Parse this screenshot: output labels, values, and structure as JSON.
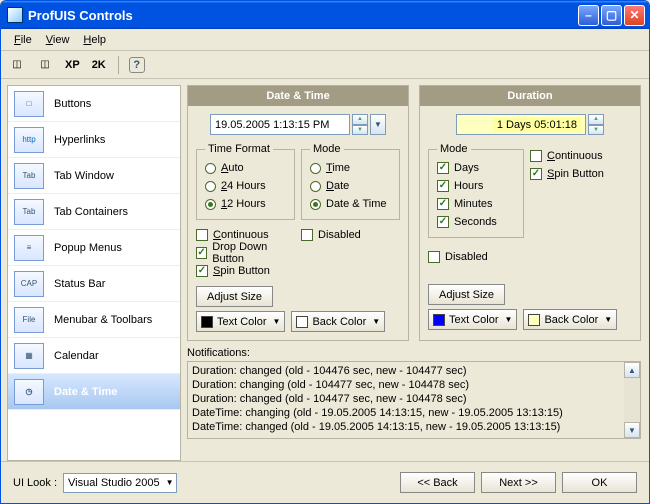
{
  "window": {
    "title": "ProfUIS Controls"
  },
  "menu": {
    "file": "File",
    "view": "View",
    "help": "Help"
  },
  "toolbar": {
    "xp": "XP",
    "k2": "2K"
  },
  "sidebar": {
    "items": [
      {
        "label": "Buttons",
        "thumb": "□"
      },
      {
        "label": "Hyperlinks",
        "thumb": "http"
      },
      {
        "label": "Tab Window",
        "thumb": "Tab"
      },
      {
        "label": "Tab Containers",
        "thumb": "Tab"
      },
      {
        "label": "Popup Menus",
        "thumb": "≡"
      },
      {
        "label": "Status Bar",
        "thumb": "CAP"
      },
      {
        "label": "Menubar & Toolbars",
        "thumb": "File"
      },
      {
        "label": "Calendar",
        "thumb": "▦"
      },
      {
        "label": "Date & Time",
        "thumb": "◷"
      }
    ]
  },
  "datetime": {
    "header": "Date & Time",
    "value": "19.05.2005 1:13:15 PM",
    "timeformat": {
      "legend": "Time Format",
      "auto": "Auto",
      "h24": "24 Hours",
      "h12": "12 Hours",
      "selected": "h12"
    },
    "mode": {
      "legend": "Mode",
      "time": "Time",
      "date": "Date",
      "both": "Date & Time",
      "selected": "both"
    },
    "continuous": "Continuous",
    "disabled": "Disabled",
    "dropdown": "Drop Down Button",
    "spin": "Spin Button",
    "adjust": "Adjust Size",
    "textcolor": "Text Color",
    "backcolor": "Back Color",
    "textcolor_value": "#000000",
    "backcolor_value": "#ffffff"
  },
  "duration": {
    "header": "Duration",
    "value": "1 Days 05:01:18",
    "mode": {
      "legend": "Mode",
      "days": "Days",
      "hours": "Hours",
      "minutes": "Minutes",
      "seconds": "Seconds"
    },
    "continuous": "Continuous",
    "spin": "Spin Button",
    "disabled": "Disabled",
    "adjust": "Adjust Size",
    "textcolor": "Text Color",
    "backcolor": "Back Color",
    "textcolor_value": "#0000ff",
    "backcolor_value": "#ffffc0"
  },
  "notif": {
    "label": "Notifications:",
    "lines": [
      "Duration: changed (old - 104476 sec, new - 104477 sec)",
      "Duration: changing (old - 104477 sec, new - 104478 sec)",
      "Duration: changed (old - 104477 sec, new - 104478 sec)",
      "DateTime: changing (old - 19.05.2005 14:13:15, new - 19.05.2005 13:13:15)",
      "DateTime: changed (old - 19.05.2005 14:13:15, new - 19.05.2005 13:13:15)"
    ]
  },
  "footer": {
    "uilook_label": "UI Look :",
    "uilook_value": "Visual Studio 2005",
    "back": "<< Back",
    "next": "Next >>",
    "ok": "OK"
  }
}
